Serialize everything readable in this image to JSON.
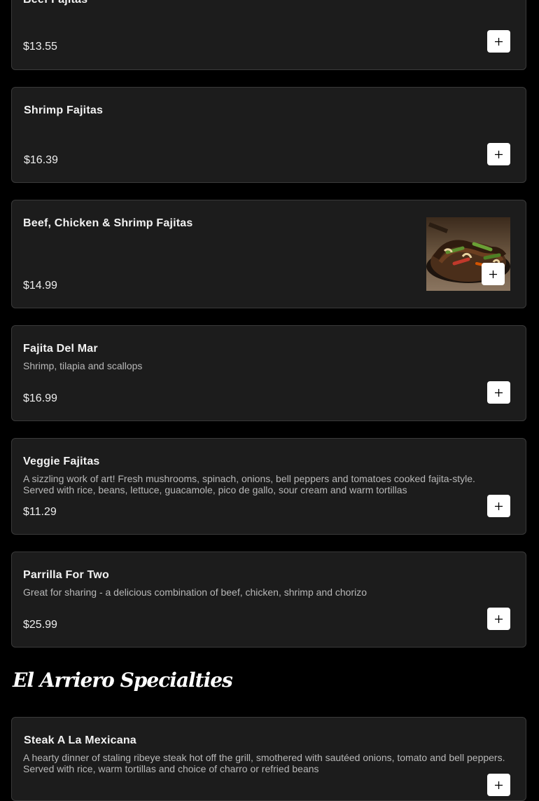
{
  "items": [
    {
      "name": "Beef Fajitas",
      "description": "",
      "price": "$13.55"
    },
    {
      "name": "Shrimp Fajitas",
      "description": "",
      "price": "$16.39"
    },
    {
      "name": "Beef, Chicken & Shrimp Fajitas",
      "description": "",
      "price": "$14.99",
      "has_image": true
    },
    {
      "name": "Fajita Del Mar",
      "description": "Shrimp, tilapia and scallops",
      "price": "$16.99"
    },
    {
      "name": "Veggie Fajitas",
      "description": "A sizzling work of art! Fresh mushrooms, spinach, onions, bell peppers and tomatoes cooked fajita-style. Served with rice, beans, lettuce, guacamole, pico de gallo, sour cream and warm tortillas",
      "price": "$11.29"
    },
    {
      "name": "Parrilla For Two",
      "description": "Great for sharing - a delicious combination of beef, chicken, shrimp and chorizo",
      "price": "$25.99"
    }
  ],
  "section": {
    "title": "El Arriero Specialties"
  },
  "section_items": [
    {
      "name": "Steak A La Mexicana",
      "description": "A hearty dinner of staling ribeye steak hot off the grill, smothered with sautéed onions, tomato and bell peppers. Served with rice, warm tortillas and choice of charro or refried beans"
    }
  ],
  "icons": {
    "add": "plus-icon"
  },
  "colors": {
    "background": "#000000",
    "card": "#1c1c1c",
    "card_border": "#3a3a3a",
    "add_button": "#ffffff"
  }
}
